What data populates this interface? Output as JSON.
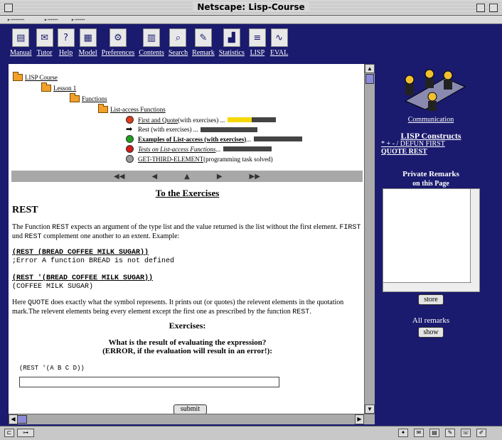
{
  "window": {
    "title": "Netscape: Lisp-Course"
  },
  "toolbar": {
    "items": [
      {
        "label": "Manual",
        "glyph": "▤"
      },
      {
        "label": "Tutor",
        "glyph": "✉"
      },
      {
        "label": "Help",
        "glyph": "?"
      },
      {
        "label": "Model",
        "glyph": "▦"
      },
      {
        "label": "Preferences",
        "glyph": "⚙"
      },
      {
        "label": "Contents",
        "glyph": "▥"
      },
      {
        "label": "Search",
        "glyph": "⌕"
      },
      {
        "label": "Remark",
        "glyph": "✎"
      },
      {
        "label": "Statistics",
        "glyph": "▟"
      },
      {
        "label": "LISP",
        "glyph": "≡"
      },
      {
        "label": "EVAL",
        "glyph": "∿"
      }
    ]
  },
  "tree": {
    "course": "LISP Course",
    "lesson": "Lesson 1",
    "chapter": "Functions",
    "section": "List-access Functions",
    "items": [
      {
        "label": "First and Quote",
        "suffix": " (with exercises) ...",
        "progress": 0.5
      },
      {
        "label": "Rest (with exercises) ...",
        "suffix": "",
        "progress": 0
      },
      {
        "label": "Examples of List-access (with exercises)",
        "suffix": " ...",
        "progress": 0
      },
      {
        "label": "Tests on List-access Functions",
        "suffix": " ...",
        "progress": 0
      },
      {
        "label": "GET-THIRD-ELEMENT",
        "suffix": " (programming task solved)",
        "progress": null
      }
    ],
    "status_colors": {
      "orange_red": "#e23a1a",
      "green": "#1aa31a",
      "red": "#d41a1a",
      "gray": "#9a9a9a",
      "progress_fill": "#f5d800"
    }
  },
  "navbar": {
    "first": "◀◀",
    "prev": "◀",
    "up": "▲",
    "next": "▶",
    "last": "▶▶"
  },
  "content": {
    "exercise_link": "To the Exercises",
    "heading": "REST",
    "p1_a": "The Function ",
    "p1_code": "REST",
    "p1_b": " expects an argument of the type list and the value returned is the list without the first element. ",
    "p1_code2": "FIRST",
    "p1_c": " und ",
    "p1_code3": "REST",
    "p1_d": " complement one another to an extent. Example:",
    "ex1_code": "(REST (BREAD COFFEE MILK SUGAR))",
    "ex1_result": ";Error A function BREAD is not defined",
    "ex2_code": "(REST '(BREAD COFFEE MILK SUGAR))",
    "ex2_result": "(COFFEE MILK SUGAR)",
    "p2_a": "Here ",
    "p2_code": "QUOTE",
    "p2_b": " does exactly what the symbol represents. It prints out (or quotes) the relevent elements in the quotation mark.The relevent elements being every element except the first one as prescribed by the function ",
    "p2_code2": "REST",
    "p2_c": ".",
    "exercises_heading": "Exercises:",
    "question_line1": "What is the result of evaluating the expression?",
    "question_line2": "(ERROR, if the evaluation will result in an error!):",
    "expression": "(REST '(A B C D))",
    "answer_value": "",
    "submit_label": "submit"
  },
  "right": {
    "communication": "Communication",
    "lisp_constructs": "LISP Constructs",
    "constructs_line1": "* + - / DEFUN FIRST",
    "constructs_line2": "QUOTE REST",
    "private_remarks": "Private Remarks",
    "on_this_page": "on this Page",
    "remarks_value": "",
    "store_label": "store",
    "all_remarks": "All remarks",
    "show_label": "show"
  }
}
